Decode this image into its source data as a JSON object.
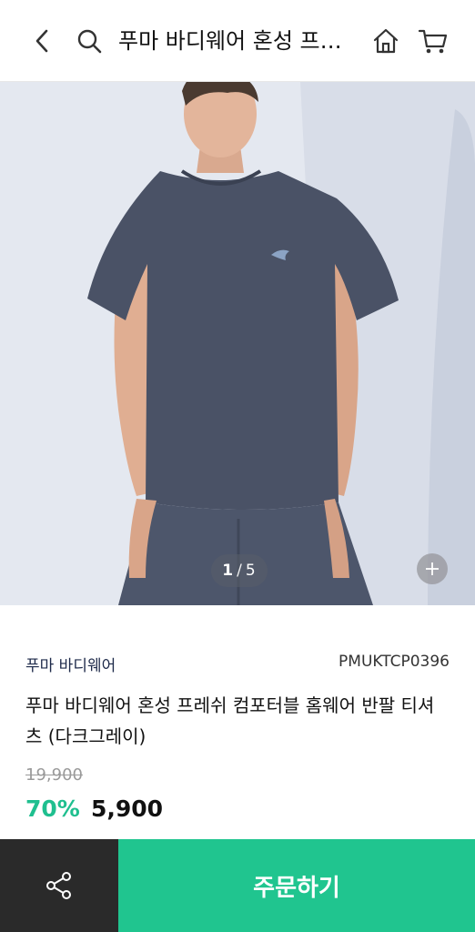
{
  "header": {
    "title": "푸마 바디웨어 혼성 프레쉬 컴포터블 홈웨어 반팔 티셔츠 (다크그레이)",
    "back_icon": "chevron-left-icon",
    "search_icon": "search-icon",
    "home_icon": "home-icon",
    "cart_icon": "cart-icon"
  },
  "gallery": {
    "current": "1",
    "separator": "/",
    "total": "5",
    "zoom_icon": "plus-icon"
  },
  "product": {
    "brand": "푸마 바디웨어",
    "code": "PMUKTCP0396",
    "name": "푸마 바디웨어 혼성 프레쉬 컴포터블 홈웨어 반팔 티셔츠 (다크그레이)",
    "original_price": "19,900",
    "discount": "70%",
    "price": "5,900"
  },
  "bottom_bar": {
    "share_icon": "share-icon",
    "order_label": "주문하기"
  },
  "colors": {
    "accent": "#20c58f",
    "discount": "#1fbf8f",
    "share_bg": "#2a2a2a",
    "brand_text": "#1e2a4a"
  }
}
